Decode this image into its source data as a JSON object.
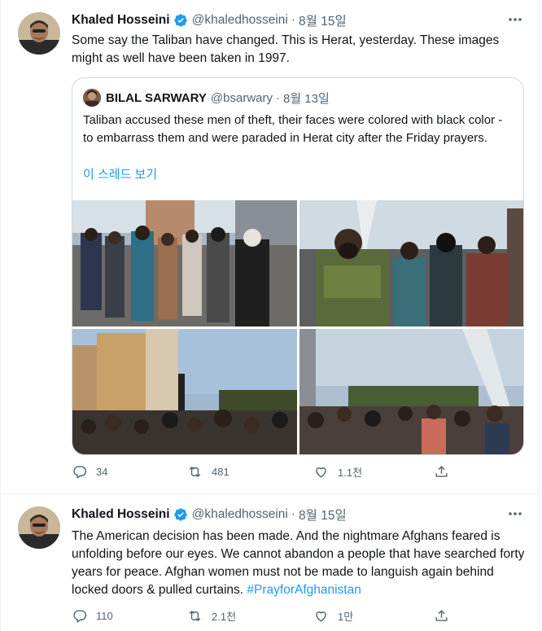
{
  "tweets": [
    {
      "author_name": "Khaled Hosseini",
      "handle": "@khaledhosseini",
      "separator": "·",
      "date": "8월 15일",
      "text": "Some say the Taliban have changed. This is Herat, yesterday. These images might as well have been taken in 1997.",
      "quote": {
        "author_name": "BILAL SARWARY",
        "handle": "@bsarwary",
        "separator": "·",
        "date": "8월 13일",
        "text": "Taliban accused these men of theft, their faces were colored with black color - to embarrass them and were paraded in Herat city after the Friday prayers.",
        "show_thread": "이 스레드 보기"
      },
      "replies": "34",
      "retweets": "481",
      "likes": "1.1천"
    },
    {
      "author_name": "Khaled Hosseini",
      "handle": "@khaledhosseini",
      "separator": "·",
      "date": "8월 15일",
      "text": "The American decision has been made. And the nightmare Afghans feared is unfolding before our eyes. We cannot abandon a people that have searched forty years for peace. Afghan women must not be made to languish again behind locked doors & pulled curtains. ",
      "hashtag": "#PrayforAfghanistan",
      "replies": "110",
      "retweets": "2.1천",
      "likes": "1만"
    }
  ],
  "colors": {
    "verified": "#1d9bf0",
    "link": "#1d9bf0",
    "muted": "#536471",
    "border": "#cfd9de"
  },
  "icons": [
    "verified-badge-icon",
    "more-icon",
    "reply-icon",
    "retweet-icon",
    "like-icon",
    "share-icon"
  ]
}
